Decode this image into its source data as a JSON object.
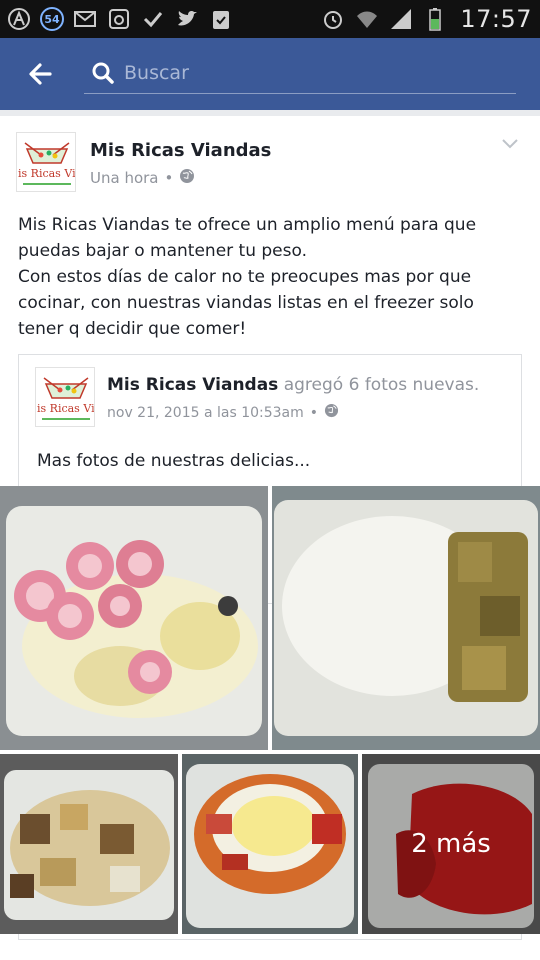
{
  "status_bar": {
    "notification_badge": "54",
    "time": "17:57",
    "icons": [
      "accessibility-icon",
      "messenger-badge-icon",
      "email-icon",
      "instagram-icon",
      "check-icon",
      "twitter-icon",
      "clipboard-check-icon",
      "alarm-icon",
      "wifi-icon",
      "signal-icon",
      "battery-icon"
    ]
  },
  "header": {
    "back_icon": "arrow-left-icon",
    "search_placeholder": "Buscar",
    "color": "#3b5998"
  },
  "post": {
    "page_name": "Mis Ricas Viandas",
    "time": "Una hora",
    "separator": "•",
    "privacy_icon": "globe-icon",
    "text": "Mis Ricas Viandas te ofrece un amplio menú para que puedas bajar o mantener tu peso.\nCon estos días de calor no te preocupes mas por que cocinar, con nuestras viandas listas en el freezer solo tener q decidir que comer!",
    "avatar_text": "is Ricas Via"
  },
  "shared_post": {
    "page_name": "Mis Ricas Viandas",
    "action": "agregó 6 fotos nuevas.",
    "date": "nov 21, 2015 a las 10:53am",
    "separator": "•",
    "text": "Mas fotos de nuestras delicias...",
    "avatar_text": "is Ricas Viar"
  },
  "photos": {
    "more_label": "2 más"
  }
}
